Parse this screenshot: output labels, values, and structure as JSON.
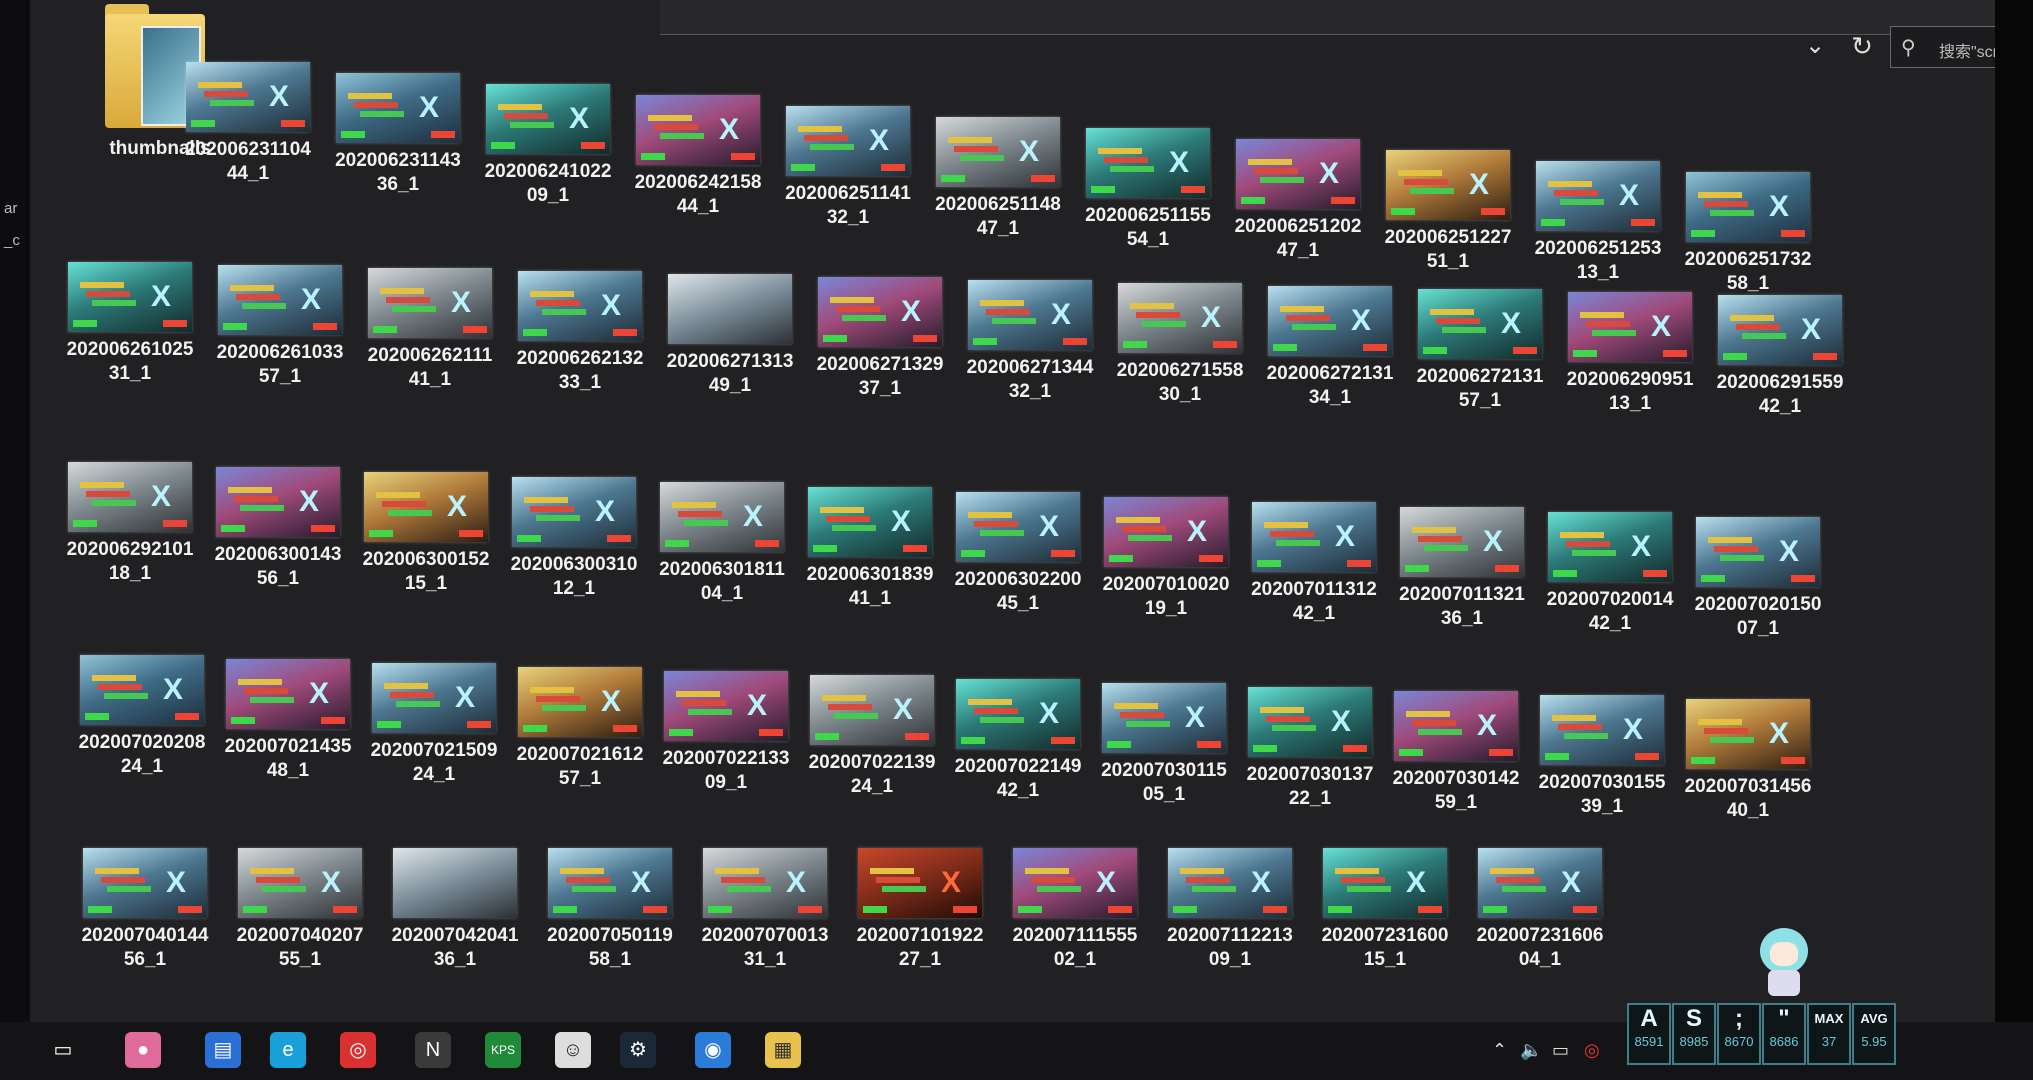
{
  "window": {
    "search_placeholder": "搜索\"scr...",
    "nav_dropdown_icon": "chevron-down-icon",
    "refresh_icon": "refresh-icon"
  },
  "left_pane_fragments": [
    "ar",
    "_c"
  ],
  "folder": {
    "name": "thumbnails"
  },
  "files": [
    [
      "202006231104",
      "44_1"
    ],
    [
      "202006231143",
      "36_1"
    ],
    [
      "202006241022",
      "09_1"
    ],
    [
      "202006242158",
      "44_1"
    ],
    [
      "202006251141",
      "32_1"
    ],
    [
      "202006251148",
      "47_1"
    ],
    [
      "202006251155",
      "54_1"
    ],
    [
      "202006251202",
      "47_1"
    ],
    [
      "202006251227",
      "51_1"
    ],
    [
      "202006251253",
      "13_1"
    ],
    [
      "202006251732",
      "58_1"
    ],
    [
      "202006261025",
      "31_1"
    ],
    [
      "202006261033",
      "57_1"
    ],
    [
      "202006262111",
      "41_1"
    ],
    [
      "202006262132",
      "33_1"
    ],
    [
      "202006271313",
      "49_1"
    ],
    [
      "202006271329",
      "37_1"
    ],
    [
      "202006271344",
      "32_1"
    ],
    [
      "202006271558",
      "30_1"
    ],
    [
      "202006272131",
      "34_1"
    ],
    [
      "202006272131",
      "57_1"
    ],
    [
      "202006290951",
      "13_1"
    ],
    [
      "202006291559",
      "42_1"
    ],
    [
      "202006292101",
      "18_1"
    ],
    [
      "202006300143",
      "56_1"
    ],
    [
      "202006300152",
      "15_1"
    ],
    [
      "202006300310",
      "12_1"
    ],
    [
      "202006301811",
      "04_1"
    ],
    [
      "202006301839",
      "41_1"
    ],
    [
      "202006302200",
      "45_1"
    ],
    [
      "202007010020",
      "19_1"
    ],
    [
      "202007011312",
      "42_1"
    ],
    [
      "202007011321",
      "36_1"
    ],
    [
      "202007020014",
      "42_1"
    ],
    [
      "202007020150",
      "07_1"
    ],
    [
      "202007020208",
      "24_1"
    ],
    [
      "202007021435",
      "48_1"
    ],
    [
      "202007021509",
      "24_1"
    ],
    [
      "202007021612",
      "57_1"
    ],
    [
      "202007022133",
      "09_1"
    ],
    [
      "202007022139",
      "24_1"
    ],
    [
      "202007022149",
      "42_1"
    ],
    [
      "202007030115",
      "05_1"
    ],
    [
      "202007030137",
      "22_1"
    ],
    [
      "202007030142",
      "59_1"
    ],
    [
      "202007030155",
      "39_1"
    ],
    [
      "202007031456",
      "40_1"
    ],
    [
      "202007040144",
      "56_1"
    ],
    [
      "202007040207",
      "55_1"
    ],
    [
      "202007042041",
      "36_1"
    ],
    [
      "202007050119",
      "58_1"
    ],
    [
      "202007070013",
      "31_1"
    ],
    [
      "202007101922",
      "27_1"
    ],
    [
      "202007111555",
      "02_1"
    ],
    [
      "202007112213",
      "09_1"
    ],
    [
      "202007231600",
      "15_1"
    ],
    [
      "202007231606",
      "04_1"
    ]
  ],
  "taskbar": {
    "icons": [
      "task-view-icon",
      "app-icon",
      "file-explorer-icon",
      "edge-icon",
      "netease-music-icon",
      "notion-icon",
      "wps-icon",
      "game-app-icon",
      "steam-icon",
      "app-icon",
      "folder-icon"
    ],
    "tray_icons": [
      "chevron-up-icon",
      "speaker-icon",
      "battery-icon",
      "netease-tray-icon"
    ]
  },
  "key_overlay": [
    {
      "key": "A",
      "count": "8591"
    },
    {
      "key": "S",
      "count": "8985"
    },
    {
      "key": ";",
      "count": "8670"
    },
    {
      "key": "\"",
      "count": "8686"
    },
    {
      "key": "MAX",
      "count": "37"
    },
    {
      "key": "AVG",
      "count": "5.95"
    }
  ]
}
